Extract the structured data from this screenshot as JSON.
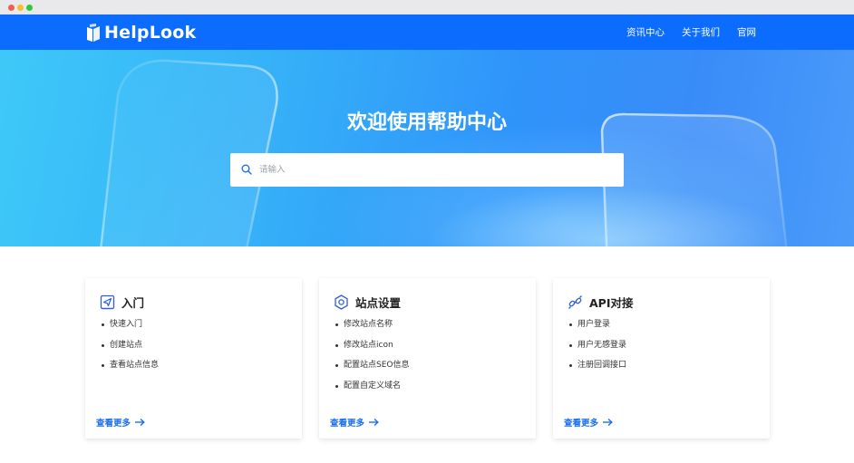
{
  "brand": {
    "name": "HelpLook"
  },
  "nav": {
    "links": [
      {
        "label": "资讯中心"
      },
      {
        "label": "关于我们"
      },
      {
        "label": "官网"
      }
    ]
  },
  "hero": {
    "title": "欢迎使用帮助中心",
    "search": {
      "placeholder": "请输入",
      "value": ""
    }
  },
  "cards": [
    {
      "icon": "send-icon",
      "title": "入门",
      "items": [
        "快速入门",
        "创建站点",
        "查看站点信息"
      ],
      "more_label": "查看更多"
    },
    {
      "icon": "hexagon-settings-icon",
      "title": "站点设置",
      "items": [
        "修改站点名称",
        "修改站点icon",
        "配置站点SEO信息",
        "配置自定义域名"
      ],
      "more_label": "查看更多"
    },
    {
      "icon": "api-link-icon",
      "title": "API对接",
      "items": [
        "用户登录",
        "用户无感登录",
        "注册回调接口"
      ],
      "more_label": "查看更多"
    }
  ],
  "colors": {
    "nav_bg": "#0b6cfe",
    "accent": "#1a6ef0",
    "hero_gradient_start": "#3ec8f8",
    "hero_gradient_end": "#4b9bfa"
  }
}
